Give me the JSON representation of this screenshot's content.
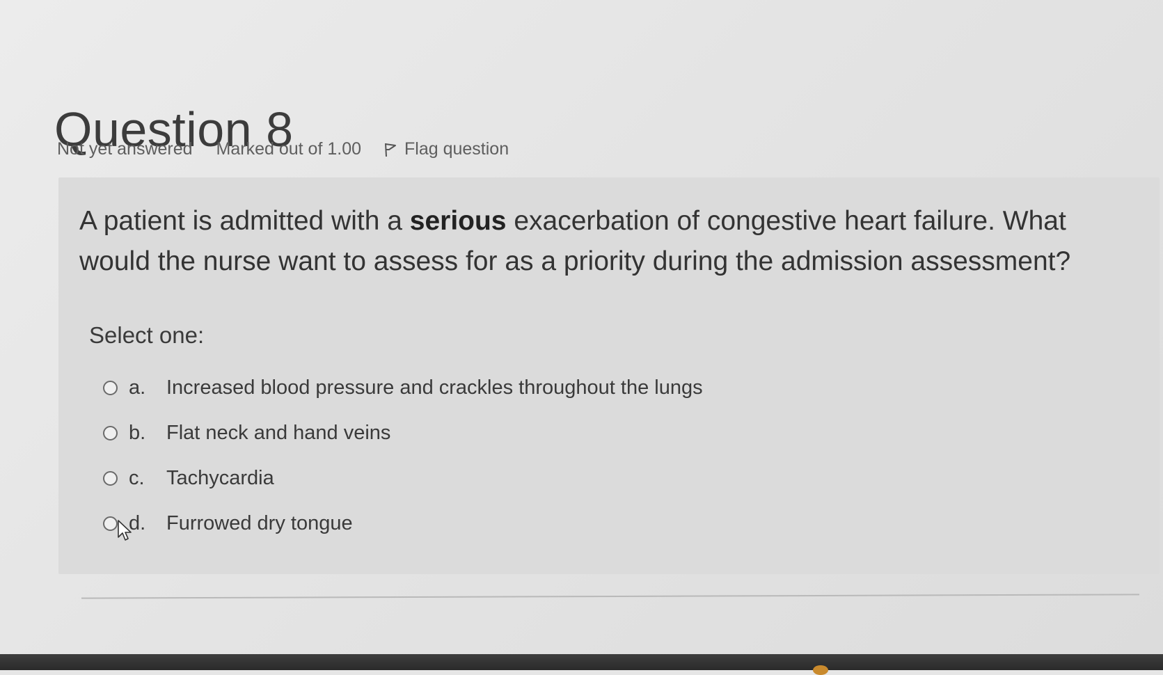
{
  "question": {
    "title": "Question 8",
    "status": "Not yet answered",
    "marked": "Marked out of 1.00",
    "flag_label": "Flag question",
    "text_before": "A patient is admitted with a ",
    "text_bold": "serious",
    "text_after": " exacerbation of congestive heart failure. What would the nurse want to assess for as a priority during the admission assessment?",
    "select_prompt": "Select one:",
    "answers": [
      {
        "letter": "a.",
        "text": "Increased blood pressure and crackles throughout the lungs"
      },
      {
        "letter": "b.",
        "text": "Flat neck and hand veins"
      },
      {
        "letter": "c.",
        "text": "Tachycardia"
      },
      {
        "letter": "d.",
        "text": "Furrowed dry tongue"
      }
    ]
  },
  "icons": {
    "flag": "flag-icon",
    "radio": "radio-unchecked-icon",
    "cursor": "mouse-pointer-icon"
  },
  "colors": {
    "background": "#e6e6e6",
    "question_box": "#dbdbdb",
    "text": "#333333",
    "meta_text": "#5e5e5e"
  }
}
